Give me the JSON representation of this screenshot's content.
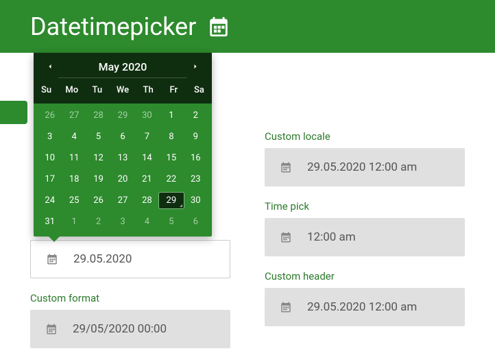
{
  "header": {
    "title": "Datetimepicker"
  },
  "calendar": {
    "month_label": "May 2020",
    "dow": [
      "Su",
      "Mo",
      "Tu",
      "We",
      "Th",
      "Fr",
      "Sa"
    ],
    "days": [
      {
        "n": "26",
        "muted": true
      },
      {
        "n": "27",
        "muted": true
      },
      {
        "n": "28",
        "muted": true
      },
      {
        "n": "29",
        "muted": true
      },
      {
        "n": "30",
        "muted": true
      },
      {
        "n": "1"
      },
      {
        "n": "2"
      },
      {
        "n": "3"
      },
      {
        "n": "4"
      },
      {
        "n": "5"
      },
      {
        "n": "6"
      },
      {
        "n": "7"
      },
      {
        "n": "8"
      },
      {
        "n": "9"
      },
      {
        "n": "10"
      },
      {
        "n": "11"
      },
      {
        "n": "12"
      },
      {
        "n": "13"
      },
      {
        "n": "14"
      },
      {
        "n": "15"
      },
      {
        "n": "16"
      },
      {
        "n": "17"
      },
      {
        "n": "18"
      },
      {
        "n": "19"
      },
      {
        "n": "20"
      },
      {
        "n": "21"
      },
      {
        "n": "22"
      },
      {
        "n": "23"
      },
      {
        "n": "24"
      },
      {
        "n": "25"
      },
      {
        "n": "26"
      },
      {
        "n": "27"
      },
      {
        "n": "28"
      },
      {
        "n": "29",
        "selected": true
      },
      {
        "n": "30"
      },
      {
        "n": "31"
      },
      {
        "n": "1",
        "muted": true
      },
      {
        "n": "2",
        "muted": true
      },
      {
        "n": "3",
        "muted": true
      },
      {
        "n": "4",
        "muted": true
      },
      {
        "n": "5",
        "muted": true
      },
      {
        "n": "6",
        "muted": true
      }
    ]
  },
  "left": {
    "date_value": "29.05.2020",
    "custom_format_label": "Custom format",
    "custom_format_value": "29/05/2020 00:00"
  },
  "right": {
    "custom_locale_label": "Custom locale",
    "custom_locale_value": "29.05.2020 12:00 am",
    "time_pick_label": "Time pick",
    "time_pick_value": "12:00 am",
    "custom_header_label": "Custom header",
    "custom_header_value": "29.05.2020 12:00 am"
  }
}
